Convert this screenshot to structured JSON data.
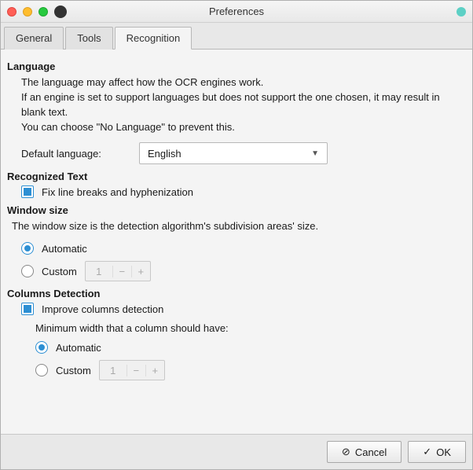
{
  "window": {
    "title": "Preferences"
  },
  "tabs": {
    "general": "General",
    "tools": "Tools",
    "recognition": "Recognition"
  },
  "language": {
    "heading": "Language",
    "desc_line1": "The language may affect how the OCR engines work.",
    "desc_line2": "If an engine is set to support languages but does not support the one chosen, it may result in blank text.",
    "desc_line3": "You can choose \"No Language\" to prevent this.",
    "default_label": "Default language:",
    "selected": "English"
  },
  "recognized_text": {
    "heading": "Recognized Text",
    "fix_line_breaks": "Fix line breaks and hyphenization",
    "fix_checked": true
  },
  "window_size": {
    "heading": "Window size",
    "desc": "The window size is the detection algorithm's subdivision areas' size.",
    "automatic": "Automatic",
    "custom": "Custom",
    "custom_value": "1",
    "selected": "automatic"
  },
  "columns": {
    "heading": "Columns Detection",
    "improve_label": "Improve columns detection",
    "improve_checked": true,
    "min_width_label": "Minimum width that a column should have:",
    "automatic": "Automatic",
    "custom": "Custom",
    "custom_value": "1",
    "selected": "automatic"
  },
  "footer": {
    "cancel": "Cancel",
    "ok": "OK"
  }
}
